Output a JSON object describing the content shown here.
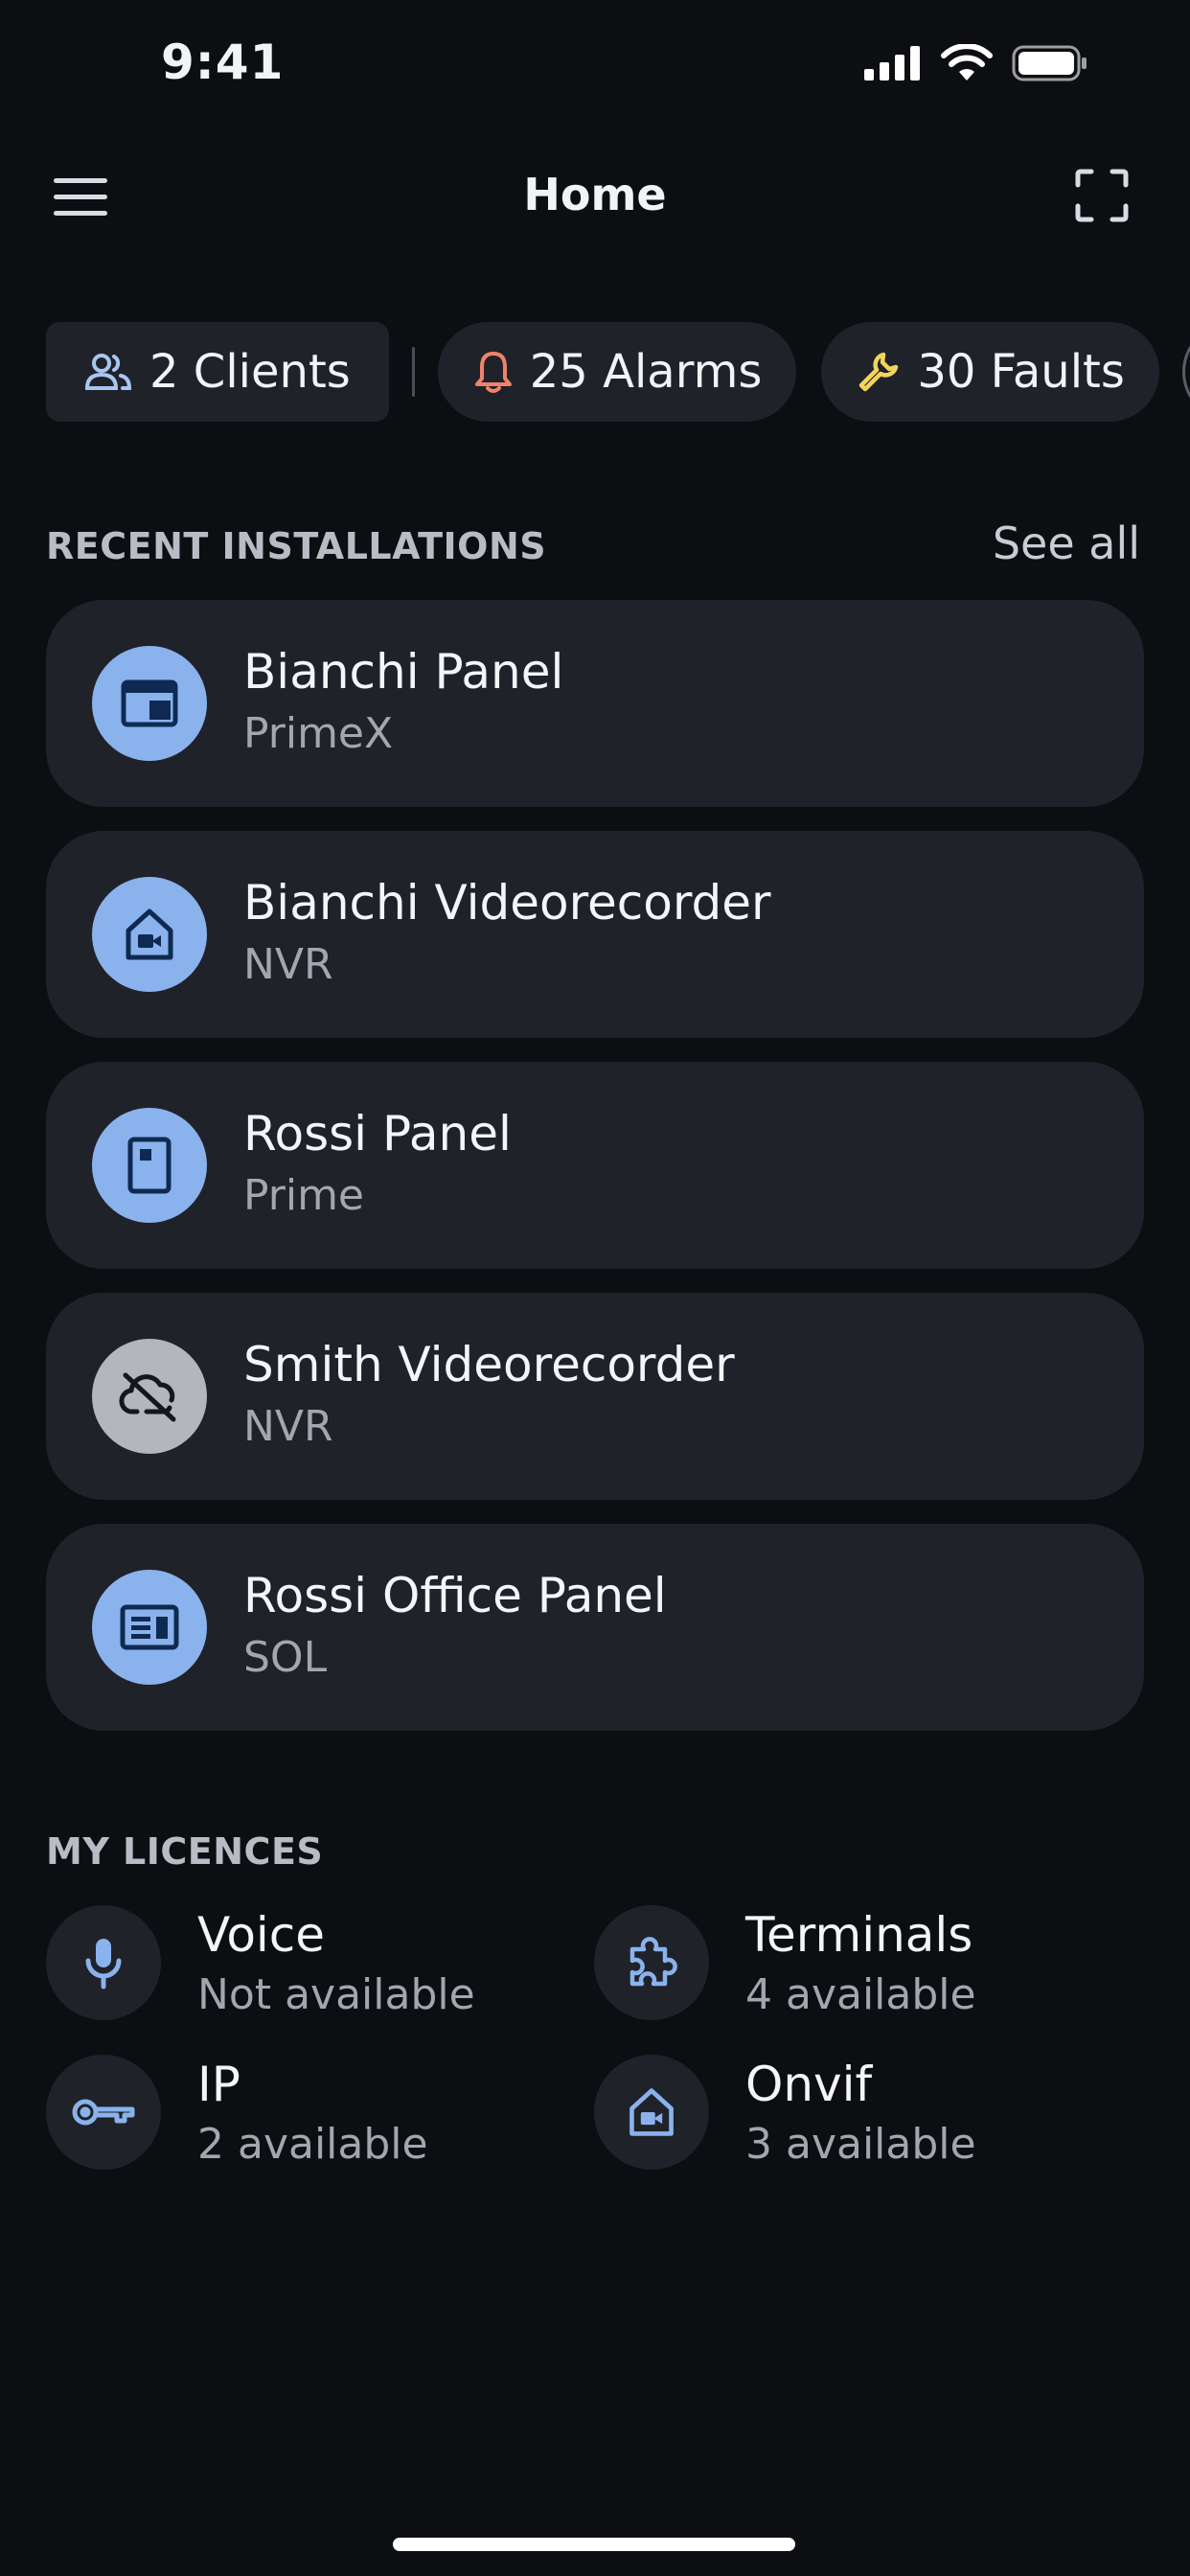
{
  "status_bar": {
    "time": "9:41"
  },
  "header": {
    "title": "Home"
  },
  "chips": [
    {
      "label": "2 Clients",
      "icon": "users-icon"
    },
    {
      "label": "25 Alarms",
      "icon": "bell-icon",
      "color": "#f0826c"
    },
    {
      "label": "30 Faults",
      "icon": "wrench-icon",
      "color": "#f3d45c"
    }
  ],
  "recent": {
    "heading": "RECENT INSTALLATIONS",
    "see_all": "See all",
    "items": [
      {
        "title": "Bianchi Panel",
        "subtitle": "PrimeX",
        "icon": "panel-window-icon"
      },
      {
        "title": "Bianchi Videorecorder",
        "subtitle": "NVR",
        "icon": "home-camera-icon"
      },
      {
        "title": "Rossi Panel",
        "subtitle": "Prime",
        "icon": "panel-device-icon"
      },
      {
        "title": "Smith Videorecorder",
        "subtitle": "NVR",
        "icon": "cloud-off-icon",
        "status": "offline"
      },
      {
        "title": "Rossi Office Panel",
        "subtitle": "SOL",
        "icon": "panel-keypad-icon"
      }
    ]
  },
  "licences": {
    "heading": "MY LICENCES",
    "items": [
      {
        "title": "Voice",
        "subtitle": "Not available",
        "icon": "microphone-icon"
      },
      {
        "title": "Terminals",
        "subtitle": "4 available",
        "icon": "puzzle-icon"
      },
      {
        "title": "IP",
        "subtitle": "2 available",
        "icon": "key-icon"
      },
      {
        "title": "Onvif",
        "subtitle": "3 available",
        "icon": "home-camera-icon"
      }
    ]
  },
  "colors": {
    "background": "#0c0e12",
    "card": "#202229",
    "accent_icon": "#8ab2ec",
    "icon_dark": "#0f2a52",
    "alarm": "#f0826c",
    "fault": "#f3d45c"
  }
}
